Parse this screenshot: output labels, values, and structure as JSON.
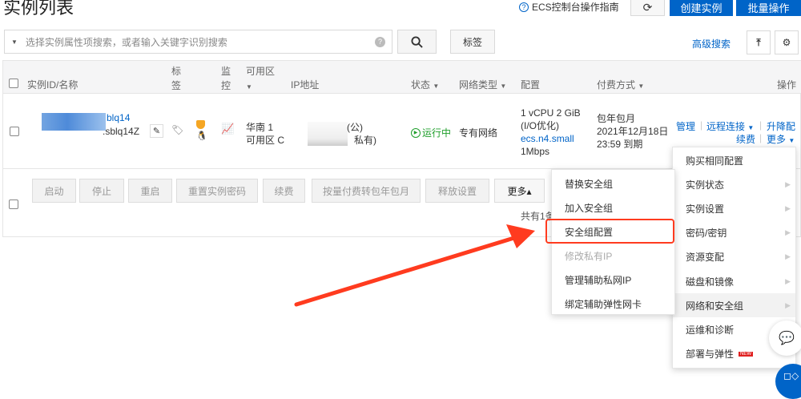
{
  "header": {
    "title": "实例列表",
    "guide_link": "ECS控制台操作指南",
    "create_button": "创建实例",
    "batch_button": "批量操作"
  },
  "search": {
    "placeholder": "选择实例属性项搜索，或者输入关键字识别搜索",
    "tag_button": "标签",
    "advanced": "高级搜索"
  },
  "table": {
    "headers": {
      "id": "实例ID/名称",
      "tag": "标签",
      "monitor": "监控",
      "zone": "可用区",
      "ip": "IP地址",
      "status": "状态",
      "network": "网络类型",
      "config": "配置",
      "billing": "付费方式",
      "actions": "操作"
    },
    "row": {
      "id_line1": "blq14",
      "id_line2": ".sblq14Z",
      "zone_line1": "华南 1",
      "zone_line2": "可用区 C",
      "ip_public_suffix": "(公)",
      "ip_private_suffix": "私有)",
      "status": "运行中",
      "network": "专有网络",
      "config_line1": "1 vCPU 2 GiB",
      "config_line2": "(I/O优化)",
      "config_type": "ecs.n4.small",
      "config_bw": "1Mbps",
      "billing_line1": "包年包月",
      "billing_line2": "2021年12月18日",
      "billing_line3": "23:59 到期",
      "actions": {
        "manage": "管理",
        "remote": "远程连接",
        "resize": "升降配",
        "renew": "续费",
        "more": "更多"
      }
    },
    "footer_buttons": [
      "启动",
      "停止",
      "重启",
      "重置实例密码",
      "续费",
      "按量付费转包年包月",
      "释放设置",
      "更多▴"
    ],
    "total": "共有1条"
  },
  "more_menu": [
    {
      "label": "购买相同配置",
      "sub": false
    },
    {
      "label": "实例状态",
      "sub": true
    },
    {
      "label": "实例设置",
      "sub": true
    },
    {
      "label": "密码/密钥",
      "sub": true
    },
    {
      "label": "资源变配",
      "sub": true
    },
    {
      "label": "磁盘和镜像",
      "sub": true
    },
    {
      "label": "网络和安全组",
      "sub": true,
      "active": true
    },
    {
      "label": "运维和诊断",
      "sub": false
    },
    {
      "label": "部署与弹性",
      "sub": false,
      "badge": "NEW"
    }
  ],
  "sub_menu": [
    {
      "label": "替换安全组"
    },
    {
      "label": "加入安全组"
    },
    {
      "label": "安全组配置",
      "highlighted": true
    },
    {
      "label": "修改私有IP",
      "disabled": true
    },
    {
      "label": "管理辅助私网IP"
    },
    {
      "label": "绑定辅助弹性网卡"
    }
  ],
  "colors": {
    "primary": "#0064c8",
    "running": "#1e9e2a",
    "annotation": "#ff3b1f"
  }
}
